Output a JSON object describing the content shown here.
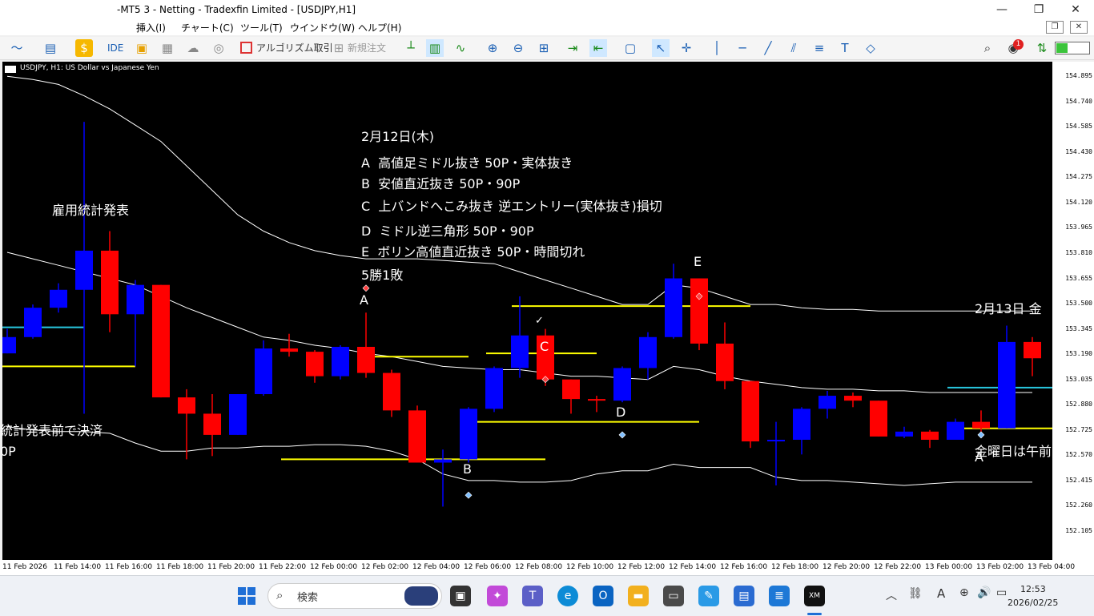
{
  "window": {
    "title": "-MT5 3 - Netting - Tradexfin Limited - [USDJPY,H1]",
    "minimize": "—",
    "maximize": "❐",
    "close": "✕"
  },
  "menu": {
    "items": [
      "挿入(I)",
      "チャート(C)",
      "ツール(T)",
      "ウインドウ(W)",
      "ヘルプ(H)"
    ]
  },
  "toolbar": {
    "ide": "IDE",
    "algo": "アルゴリズム取引",
    "neworder": "新規注文",
    "notif_count": "1"
  },
  "chart": {
    "label": "USDJPY, H1:  US Dollar vs Japanese Yen",
    "notes": {
      "date": "2月12日(木)",
      "lines": [
        {
          "k": "A",
          "t": "高値足ミドル抜き  50P・実体抜き"
        },
        {
          "k": "B",
          "t": "安値直近抜き  50P・90P"
        },
        {
          "k": "C",
          "t": "上バンドへこみ抜き  逆エントリー(実体抜き)損切"
        },
        {
          "k": "D",
          "t": "ミドル逆三角形  50P・90P"
        },
        {
          "k": "E",
          "t": "ボリン高値直近抜き  50P・時間切れ"
        }
      ],
      "result": "5勝1敗",
      "employment": "雇用統計発表",
      "settle": "統計発表前で決済",
      "partial": "0P",
      "next_date": "2月13日  金",
      "friday": "金曜日は午前"
    },
    "letters": {
      "A": "A",
      "B": "B",
      "C": "C",
      "D": "D",
      "E": "E",
      "A2": "A",
      "check": "✓"
    }
  },
  "chart_data": {
    "type": "candlestick",
    "symbol": "USDJPY",
    "timeframe": "H1",
    "ylim": [
      152.1,
      154.95
    ],
    "y_ticks": [
      "154.895",
      "154.740",
      "154.585",
      "154.430",
      "154.275",
      "154.120",
      "153.965",
      "153.810",
      "153.655",
      "153.500",
      "153.345",
      "153.190",
      "153.035",
      "152.880",
      "152.725",
      "152.570",
      "152.415",
      "152.260",
      "152.105"
    ],
    "x_ticks": [
      "11 Feb 2026",
      "11 Feb 14:00",
      "11 Feb 16:00",
      "11 Feb 18:00",
      "11 Feb 20:00",
      "11 Feb 22:00",
      "12 Feb 00:00",
      "12 Feb 02:00",
      "12 Feb 04:00",
      "12 Feb 06:00",
      "12 Feb 08:00",
      "12 Feb 10:00",
      "12 Feb 12:00",
      "12 Feb 14:00",
      "12 Feb 16:00",
      "12 Feb 18:00",
      "12 Feb 20:00",
      "12 Feb 22:00",
      "13 Feb 00:00",
      "13 Feb 02:00",
      "13 Feb 04:00"
    ],
    "candles": [
      {
        "o": 153.2,
        "h": 153.35,
        "l": 153.2,
        "c": 153.3
      },
      {
        "o": 153.3,
        "h": 153.5,
        "l": 153.29,
        "c": 153.48
      },
      {
        "o": 153.48,
        "h": 153.63,
        "l": 153.45,
        "c": 153.59
      },
      {
        "o": 153.59,
        "h": 154.62,
        "l": 152.83,
        "c": 153.83
      },
      {
        "o": 153.83,
        "h": 153.95,
        "l": 153.33,
        "c": 153.44
      },
      {
        "o": 153.44,
        "h": 153.65,
        "l": 153.12,
        "c": 153.62
      },
      {
        "o": 153.62,
        "h": 153.62,
        "l": 152.93,
        "c": 152.93
      },
      {
        "o": 152.93,
        "h": 152.98,
        "l": 152.55,
        "c": 152.83
      },
      {
        "o": 152.83,
        "h": 152.95,
        "l": 152.57,
        "c": 152.7
      },
      {
        "o": 152.7,
        "h": 152.95,
        "l": 152.7,
        "c": 152.95
      },
      {
        "o": 152.95,
        "h": 153.28,
        "l": 152.94,
        "c": 153.23
      },
      {
        "o": 153.23,
        "h": 153.32,
        "l": 153.18,
        "c": 153.21
      },
      {
        "o": 153.21,
        "h": 153.22,
        "l": 153.02,
        "c": 153.06
      },
      {
        "o": 153.06,
        "h": 153.25,
        "l": 153.04,
        "c": 153.24
      },
      {
        "o": 153.24,
        "h": 153.45,
        "l": 153.05,
        "c": 153.08
      },
      {
        "o": 153.08,
        "h": 153.1,
        "l": 152.81,
        "c": 152.85
      },
      {
        "o": 152.85,
        "h": 152.88,
        "l": 152.53,
        "c": 152.53
      },
      {
        "o": 152.53,
        "h": 152.61,
        "l": 152.26,
        "c": 152.55
      },
      {
        "o": 152.55,
        "h": 152.87,
        "l": 152.53,
        "c": 152.86
      },
      {
        "o": 152.86,
        "h": 153.12,
        "l": 152.84,
        "c": 153.11
      },
      {
        "o": 153.11,
        "h": 153.55,
        "l": 153.05,
        "c": 153.31
      },
      {
        "o": 153.31,
        "h": 153.35,
        "l": 153.0,
        "c": 153.04
      },
      {
        "o": 153.04,
        "h": 153.04,
        "l": 152.83,
        "c": 152.92
      },
      {
        "o": 152.92,
        "h": 152.94,
        "l": 152.84,
        "c": 152.91
      },
      {
        "o": 152.91,
        "h": 153.12,
        "l": 152.9,
        "c": 153.11
      },
      {
        "o": 153.11,
        "h": 153.33,
        "l": 153.04,
        "c": 153.3
      },
      {
        "o": 153.3,
        "h": 153.75,
        "l": 153.29,
        "c": 153.66
      },
      {
        "o": 153.66,
        "h": 153.66,
        "l": 153.22,
        "c": 153.26
      },
      {
        "o": 153.26,
        "h": 153.39,
        "l": 152.98,
        "c": 153.03
      },
      {
        "o": 153.03,
        "h": 153.03,
        "l": 152.62,
        "c": 152.66
      },
      {
        "o": 152.66,
        "h": 152.78,
        "l": 152.39,
        "c": 152.67
      },
      {
        "o": 152.67,
        "h": 152.87,
        "l": 152.58,
        "c": 152.86
      },
      {
        "o": 152.86,
        "h": 152.97,
        "l": 152.8,
        "c": 152.94
      },
      {
        "o": 152.94,
        "h": 152.96,
        "l": 152.87,
        "c": 152.91
      },
      {
        "o": 152.91,
        "h": 152.91,
        "l": 152.69,
        "c": 152.69
      },
      {
        "o": 152.69,
        "h": 152.75,
        "l": 152.68,
        "c": 152.72
      },
      {
        "o": 152.72,
        "h": 152.73,
        "l": 152.62,
        "c": 152.67
      },
      {
        "o": 152.67,
        "h": 152.8,
        "l": 152.67,
        "c": 152.78
      },
      {
        "o": 152.78,
        "h": 152.85,
        "l": 152.72,
        "c": 152.74
      },
      {
        "o": 152.74,
        "h": 153.37,
        "l": 152.74,
        "c": 153.27
      },
      {
        "o": 153.27,
        "h": 153.3,
        "l": 153.06,
        "c": 153.17
      }
    ],
    "upper_band": [
      154.9,
      154.88,
      154.85,
      154.78,
      154.7,
      154.6,
      154.5,
      154.35,
      154.2,
      154.05,
      153.95,
      153.88,
      153.83,
      153.8,
      153.78,
      153.78,
      153.78,
      153.77,
      153.76,
      153.75,
      153.7,
      153.65,
      153.6,
      153.55,
      153.5,
      153.5,
      153.62,
      153.6,
      153.55,
      153.5,
      153.5,
      153.48,
      153.47,
      153.47,
      153.46,
      153.46,
      153.46,
      153.46,
      153.46,
      153.46,
      153.46
    ],
    "middle_band": [
      153.82,
      153.78,
      153.74,
      153.7,
      153.66,
      153.62,
      153.55,
      153.48,
      153.42,
      153.36,
      153.3,
      153.28,
      153.25,
      153.23,
      153.2,
      153.18,
      153.15,
      153.12,
      153.11,
      153.1,
      153.1,
      153.08,
      153.06,
      153.06,
      153.05,
      153.04,
      153.12,
      153.1,
      153.06,
      153.03,
      153.01,
      152.99,
      152.98,
      152.98,
      152.97,
      152.97,
      152.96,
      152.96,
      152.96,
      152.96,
      152.96
    ],
    "lower_band": [
      152.75,
      152.73,
      152.72,
      152.72,
      152.71,
      152.65,
      152.6,
      152.6,
      152.62,
      152.62,
      152.63,
      152.63,
      152.64,
      152.64,
      152.63,
      152.6,
      152.55,
      152.46,
      152.42,
      152.42,
      152.41,
      152.41,
      152.42,
      152.46,
      152.48,
      152.48,
      152.52,
      152.5,
      152.5,
      152.5,
      152.44,
      152.42,
      152.42,
      152.41,
      152.4,
      152.39,
      152.4,
      152.41,
      152.41,
      152.41,
      152.41
    ],
    "hlines": [
      {
        "i0": 0,
        "i1": 3,
        "y": 153.36,
        "color": "#28c8e0"
      },
      {
        "i0": 0,
        "i1": 5,
        "y": 153.12,
        "color": "#ffff00"
      },
      {
        "i0": 11,
        "i1": 21,
        "y": 152.55,
        "color": "#ffff00"
      },
      {
        "i0": 14,
        "i1": 18,
        "y": 153.18,
        "color": "#ffff00"
      },
      {
        "i0": 19,
        "i1": 23,
        "y": 153.2,
        "color": "#ffff00"
      },
      {
        "i0": 18,
        "i1": 27,
        "y": 152.78,
        "color": "#ffff00"
      },
      {
        "i0": 20,
        "i1": 29,
        "y": 153.49,
        "color": "#ffff00"
      },
      {
        "i0": 37,
        "i1": 41,
        "y": 152.74,
        "color": "#ffff00"
      },
      {
        "i0": 37,
        "i1": 41,
        "y": 152.99,
        "color": "#28c8e0"
      }
    ]
  },
  "taskbar": {
    "search": "検索",
    "time": "12:53",
    "date": "2026/02/25",
    "ime": "A"
  },
  "colors": {
    "bull": "#0000ff",
    "bear": "#ff0000",
    "band": "#ffffff",
    "bg": "#000000"
  }
}
